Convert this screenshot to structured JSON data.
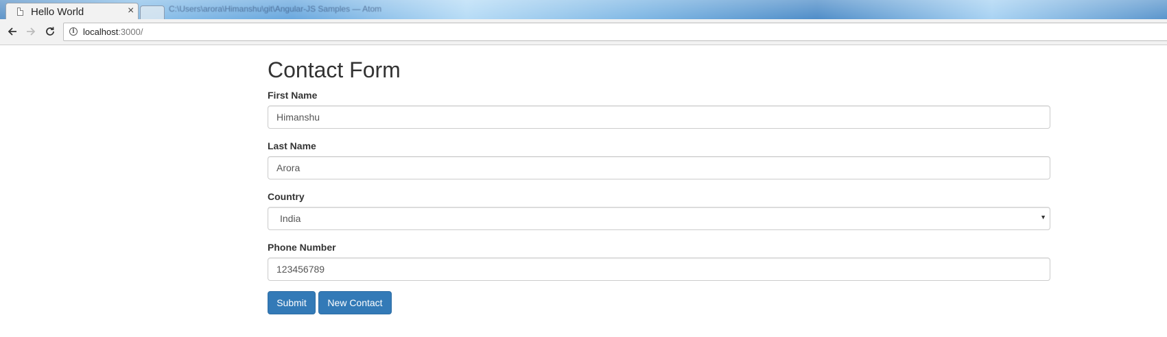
{
  "browser": {
    "tab_title": "Hello World",
    "tab_close": "×",
    "window_title": "C:\\Users\\arora\\Himanshu\\git\\Angular-JS Samples — Atom",
    "url_host": "localhost",
    "url_rest": ":3000/",
    "icons": [
      "page-icon",
      "close-icon",
      "back-arrow-icon",
      "forward-arrow-icon",
      "reload-icon",
      "info-icon"
    ]
  },
  "form": {
    "title": "Contact Form",
    "first_name": {
      "label": "First Name",
      "value": "Himanshu"
    },
    "last_name": {
      "label": "Last Name",
      "value": "Arora"
    },
    "country": {
      "label": "Country",
      "value": "India",
      "arrow": "▼"
    },
    "phone": {
      "label": "Phone Number",
      "value": "123456789"
    },
    "buttons": {
      "submit": "Submit",
      "new_contact": "New Contact"
    }
  },
  "colors": {
    "primary_button": "#337ab7",
    "primary_button_border": "#2e6da4",
    "text": "#333333",
    "input_text": "#555555",
    "input_border": "#cccccc"
  }
}
